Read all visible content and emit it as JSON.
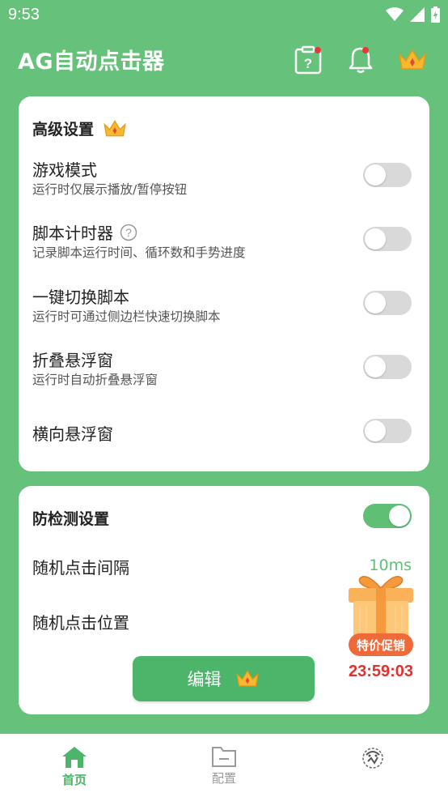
{
  "status_bar": {
    "time": "9:53"
  },
  "header": {
    "title": "AG自动点击器"
  },
  "advanced": {
    "title": "高级设置",
    "items": [
      {
        "title": "游戏模式",
        "subtitle": "运行时仅展示播放/暂停按钮",
        "enabled": false
      },
      {
        "title": "脚本计时器",
        "subtitle": "记录脚本运行时间、循环数和手势进度",
        "enabled": false
      },
      {
        "title": "一键切换脚本",
        "subtitle": "运行时可通过侧边栏快速切换脚本",
        "enabled": false
      },
      {
        "title": "折叠悬浮窗",
        "subtitle": "运行时自动折叠悬浮窗",
        "enabled": false
      },
      {
        "title": "横向悬浮窗",
        "enabled": false
      }
    ]
  },
  "anti_detect": {
    "title": "防检测设置",
    "enabled": true,
    "random_interval_label": "随机点击间隔",
    "random_interval_value": "10ms",
    "random_position_label": "随机点击位置",
    "edit_label": "编辑"
  },
  "promo": {
    "tag": "特价促销",
    "timer": "23:59:03"
  },
  "bottom_nav": {
    "items": [
      {
        "label": "首页",
        "active": true
      },
      {
        "label": "配置",
        "active": false
      },
      {
        "label": "",
        "active": false
      }
    ]
  },
  "colors": {
    "brand_green": "#66c27a",
    "accent_green": "#5fbf75",
    "timer_red": "#e0322f",
    "crown_gold": "#f5b82e"
  }
}
